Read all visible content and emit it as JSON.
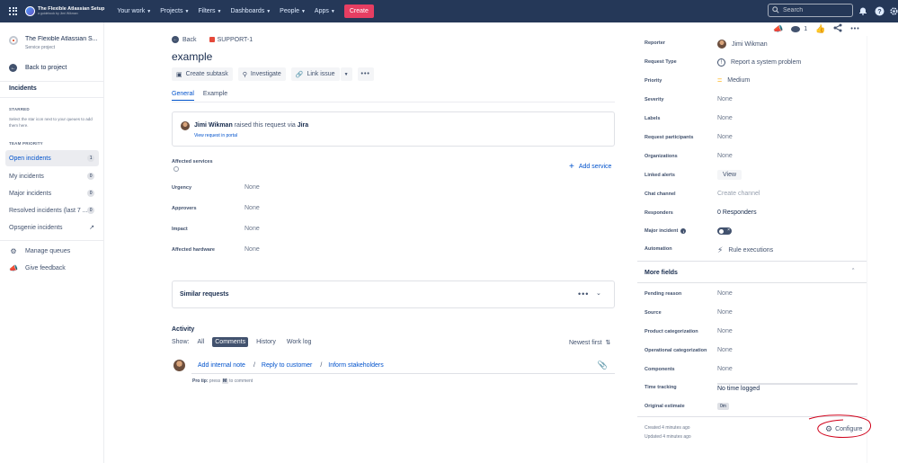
{
  "topnav": {
    "org_name": "The Flexible Atlassian Setup",
    "org_tagline": "a guidebook by Jimi Wikman",
    "menu": [
      "Your work",
      "Projects",
      "Filters",
      "Dashboards",
      "People",
      "Apps"
    ],
    "create": "Create",
    "search_placeholder": "Search"
  },
  "sidebar": {
    "project_name": "The Flexible Atlassian S...",
    "project_type": "Service project",
    "back": "Back to project",
    "section": "Incidents",
    "starred_label": "STARRED",
    "starred_help": "Select the star icon next to your queues to add them here.",
    "team_priority_label": "TEAM PRIORITY",
    "queues": [
      {
        "label": "Open incidents",
        "count": "1"
      },
      {
        "label": "My incidents",
        "count": "0"
      },
      {
        "label": "Major incidents",
        "count": "0"
      },
      {
        "label": "Resolved incidents (last 7 ...",
        "count": "0"
      },
      {
        "label": "Opsgenie incidents",
        "count": ""
      }
    ],
    "manage_queues": "Manage queues",
    "give_feedback": "Give feedback"
  },
  "issue": {
    "back": "Back",
    "key": "SUPPORT-1",
    "title": "example",
    "toolbar": {
      "create_subtask": "Create subtask",
      "investigate": "Investigate",
      "link_issue": "Link issue"
    },
    "tabs": [
      "General",
      "Example"
    ],
    "request": {
      "user": "Jimi Wikman",
      "text_mid": " raised this request via ",
      "channel": "Jira",
      "view_link": "View request in portal"
    },
    "fields": {
      "affected_services": "Affected services",
      "add_service": "Add service",
      "urgency": "Urgency",
      "urgency_val": "None",
      "approvers": "Approvers",
      "approvers_val": "None",
      "impact": "Impact",
      "impact_val": "None",
      "affected_hardware": "Affected hardware",
      "affected_hardware_val": "None"
    },
    "similar_requests": "Similar requests",
    "activity": {
      "heading": "Activity",
      "show": "Show:",
      "options": [
        "All",
        "Comments",
        "History",
        "Work log"
      ],
      "selected": "Comments",
      "sort": "Newest first",
      "comment_actions": [
        "Add internal note",
        "Reply to customer",
        "Inform stakeholders"
      ],
      "pro_tip_label": "Pro tip:",
      "pro_tip_press": "press",
      "pro_tip_key": "M",
      "pro_tip_rest": "to comment"
    }
  },
  "right_panel": {
    "watch_count": "1",
    "fields": [
      {
        "label": "Reporter",
        "value": "Jimi Wikman"
      },
      {
        "label": "Request Type",
        "value": "Report a system problem"
      },
      {
        "label": "Priority",
        "value": "Medium"
      },
      {
        "label": "Severity",
        "value": "None"
      },
      {
        "label": "Labels",
        "value": "None"
      },
      {
        "label": "Request participants",
        "value": "None"
      },
      {
        "label": "Organizations",
        "value": "None"
      },
      {
        "label": "Linked alerts",
        "value": "View"
      },
      {
        "label": "Chat channel",
        "value": "Create channel"
      },
      {
        "label": "Responders",
        "value": "0 Responders"
      },
      {
        "label": "Major incident",
        "value": ""
      },
      {
        "label": "Automation",
        "value": "Rule executions"
      }
    ],
    "more_fields": "More fields",
    "more": [
      {
        "label": "Pending reason",
        "value": "None"
      },
      {
        "label": "Source",
        "value": "None"
      },
      {
        "label": "Product categorization",
        "value": "None"
      },
      {
        "label": "Operational categorization",
        "value": "None"
      },
      {
        "label": "Components",
        "value": "None"
      },
      {
        "label": "Time tracking",
        "value": "No time logged"
      },
      {
        "label": "Original estimate",
        "value": "0m"
      }
    ],
    "created": "Created 4 minutes ago",
    "updated": "Updated 4 minutes ago",
    "configure": "Configure"
  },
  "colors": {
    "nav": "#253858",
    "create": "#e63e62",
    "link": "#0052cc",
    "annotation": "#d0021b"
  }
}
